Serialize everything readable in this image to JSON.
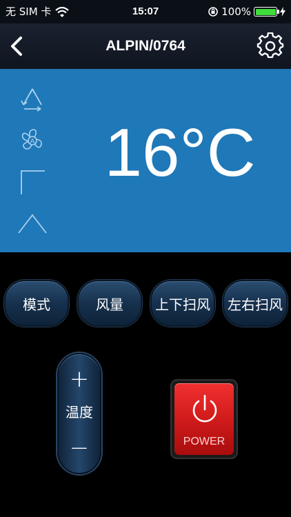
{
  "status_bar": {
    "carrier": "无 SIM 卡",
    "time": "15:07",
    "battery": "100%",
    "battery_level": 1.0,
    "battery_color": "#3fdc3a"
  },
  "nav": {
    "title": "ALPIN/0764",
    "back_icon": "chevron-left-icon",
    "settings_icon": "gear-icon"
  },
  "display": {
    "background": "#1f78b8",
    "temperature": "16°C",
    "icons": [
      "mode-cycle-icon",
      "fan-auto-icon",
      "swing-vertical-icon",
      "swing-horizontal-icon"
    ]
  },
  "controls": {
    "mode": "模式",
    "fan_speed": "风量",
    "swing_up_down": "上下扫风",
    "swing_left_right": "左右扫风"
  },
  "temperature_control": {
    "plus": "+",
    "label": "温度",
    "minus": "−"
  },
  "power": {
    "label": "POWER",
    "color": "#e02020"
  }
}
